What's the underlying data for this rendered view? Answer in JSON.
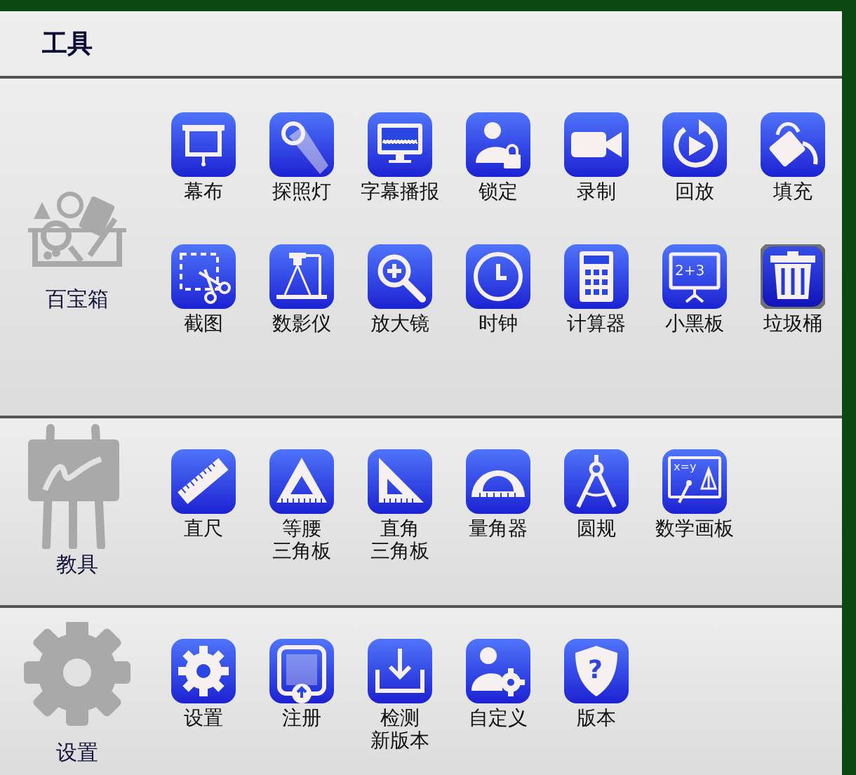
{
  "title": "工具",
  "sections": [
    {
      "kind": "toolbox",
      "label": "百宝箱",
      "items": [
        {
          "kind": "screen",
          "label": "幕布",
          "selected": false
        },
        {
          "kind": "spotlight",
          "label": "探照灯",
          "selected": false
        },
        {
          "kind": "monitor",
          "label": "字幕播报",
          "selected": false
        },
        {
          "kind": "lock",
          "label": "锁定",
          "selected": false
        },
        {
          "kind": "camera",
          "label": "录制",
          "selected": false
        },
        {
          "kind": "replay",
          "label": "回放",
          "selected": false
        },
        {
          "kind": "bucket",
          "label": "填充",
          "selected": false
        },
        {
          "kind": "scissors",
          "label": "截图",
          "selected": false
        },
        {
          "kind": "visualizer",
          "label": "数影仪",
          "selected": false
        },
        {
          "kind": "zoom",
          "label": "放大镜",
          "selected": false
        },
        {
          "kind": "clock",
          "label": "时钟",
          "selected": false
        },
        {
          "kind": "calculator",
          "label": "计算器",
          "selected": false
        },
        {
          "kind": "board",
          "label": "小黑板",
          "icon_text": "2+3",
          "selected": false
        },
        {
          "kind": "trash",
          "label": "垃圾桶",
          "selected": true
        }
      ]
    },
    {
      "kind": "easel",
      "label": "教具",
      "items": [
        {
          "kind": "ruler",
          "label": "直尺",
          "selected": false
        },
        {
          "kind": "triangle",
          "label_lines": [
            "等腰",
            "三角板"
          ],
          "selected": false
        },
        {
          "kind": "set-square",
          "label_lines": [
            "直角",
            "三角板"
          ],
          "selected": false
        },
        {
          "kind": "protractor",
          "label": "量角器",
          "selected": false
        },
        {
          "kind": "compass",
          "label": "圆规",
          "selected": false
        },
        {
          "kind": "mathboard",
          "label": "数学画板",
          "icon_text": "x=y",
          "selected": false
        }
      ]
    },
    {
      "kind": "gear",
      "label": "设置",
      "items": [
        {
          "kind": "gear",
          "label": "设置",
          "selected": false
        },
        {
          "kind": "register",
          "label": "注册",
          "selected": false
        },
        {
          "kind": "download",
          "label_lines": [
            "检测",
            "新版本"
          ],
          "selected": false
        },
        {
          "kind": "user-gear",
          "label": "自定义",
          "selected": false
        },
        {
          "kind": "shield",
          "label": "版本",
          "icon_text": "?",
          "selected": false
        }
      ]
    }
  ]
}
